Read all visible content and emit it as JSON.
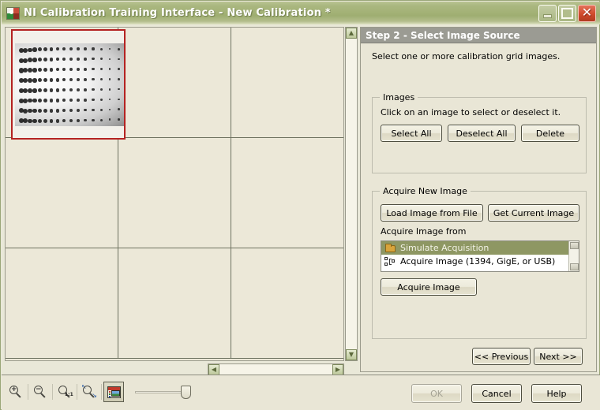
{
  "window": {
    "title": "NI Calibration Training Interface - New Calibration *",
    "icon": "ni-vision-icon",
    "controls": {
      "minimize_label": "",
      "maximize_label": "",
      "close_label": "✕"
    }
  },
  "canvas": {
    "name": "calibration-image-canvas",
    "thumbnail_alt": "calibration-grid-dot-pattern",
    "thumbnail_selected": true,
    "selection_color": "#b42222",
    "grid_columns": 3,
    "grid_rows": 3
  },
  "scrollbars": {
    "vertical": {
      "up": "▲",
      "down": "▼"
    },
    "horizontal": {
      "left": "◀",
      "right": "▶"
    }
  },
  "wizard": {
    "step_title": "Step 2 - Select Image Source",
    "intro": "Select one or more calibration grid images.",
    "images_group": {
      "title": "Images",
      "hint": "Click on an image to select or deselect it.",
      "select_all_label": "Select All",
      "deselect_all_label": "Deselect All",
      "delete_label": "Delete"
    },
    "acquire_group": {
      "title": "Acquire New Image",
      "load_file_label": "Load Image from File",
      "get_current_label": "Get Current Image",
      "source_label": "Acquire Image from",
      "sources": [
        {
          "label": "Simulate Acquisition",
          "icon": "folder-icon",
          "selected": true
        },
        {
          "label": "Acquire Image (1394, GigE, or USB)",
          "icon": "network-device-icon",
          "selected": false
        }
      ],
      "acquire_label": "Acquire Image"
    },
    "previous_label": "<< Previous",
    "next_label": "Next >>"
  },
  "bottom_bar": {
    "ok_label": "OK",
    "ok_enabled": false,
    "cancel_label": "Cancel",
    "help_label": "Help"
  },
  "toolbar": {
    "items": [
      {
        "name": "zoom-in-icon",
        "sign": "+"
      },
      {
        "name": "zoom-out-icon",
        "sign": "−"
      },
      {
        "name": "zoom-actual-size-icon",
        "ratio": "1:1"
      },
      {
        "name": "zoom-to-fit-icon",
        "ratio": ""
      },
      {
        "name": "image-palette-icon",
        "pressed": true
      }
    ],
    "zoom_slider_value": "100"
  },
  "colors": {
    "titlebar": "#a4b277",
    "panel": "#e9e6d6",
    "header": "#9b9b93",
    "list_selection": "#8e9763",
    "selection_border": "#b42222"
  }
}
